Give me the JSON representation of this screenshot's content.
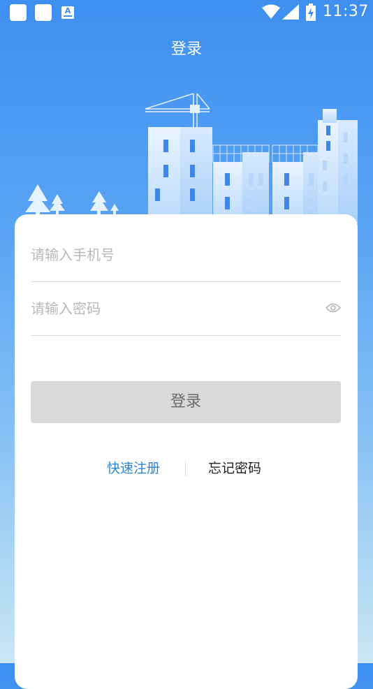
{
  "status_bar": {
    "time": "11:37",
    "notification_icons": [
      "app-notification-icon",
      "app-notification-icon",
      "text-translate-icon"
    ],
    "system_icons": [
      "wifi-icon",
      "signal-icon",
      "battery-charging-icon"
    ],
    "translate_glyph": "A"
  },
  "header": {
    "title": "登录"
  },
  "form": {
    "phone": {
      "placeholder": "请输入手机号",
      "value": ""
    },
    "password": {
      "placeholder": "请输入密码",
      "value": "",
      "toggle_icon": "eye-icon"
    },
    "submit_label": "登录"
  },
  "links": {
    "register": "快速注册",
    "forgot": "忘记密码"
  },
  "colors": {
    "accent": "#2a85d6",
    "background_top": "#3d8ff0",
    "background_bottom": "#c9e6f4",
    "button_disabled": "#d9d9d9"
  }
}
